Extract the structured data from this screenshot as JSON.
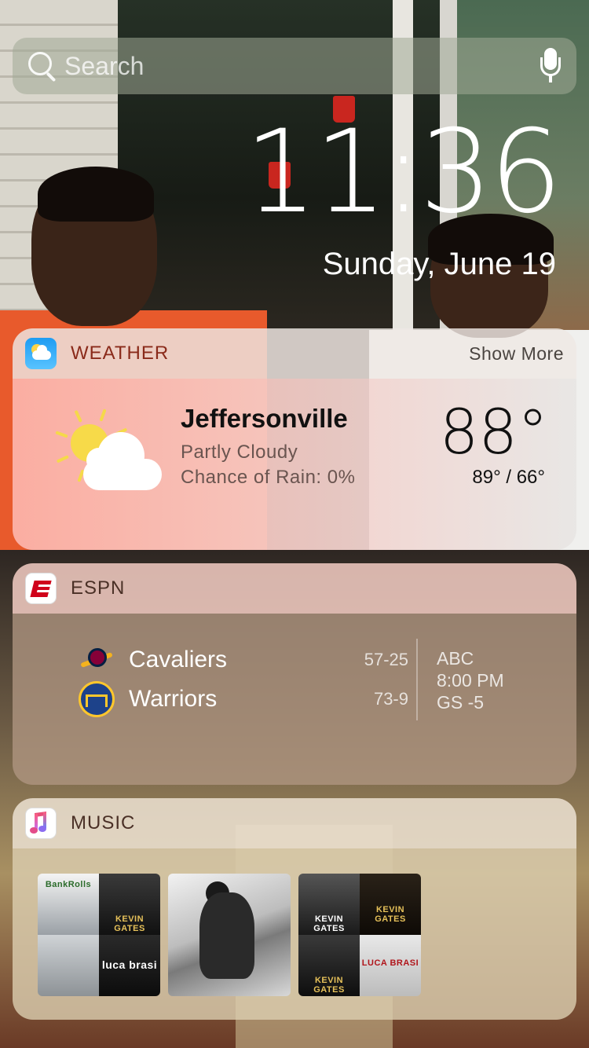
{
  "search": {
    "placeholder": "Search"
  },
  "clock": {
    "time": "11:36",
    "date": "Sunday, June 19"
  },
  "weather": {
    "title": "WEATHER",
    "show_more": "Show More",
    "city": "Jeffersonville",
    "condition": "Partly Cloudy",
    "rain": "Chance of Rain: 0%",
    "temperature": "88°",
    "hi_lo": "89° / 66°",
    "icon": "partly-cloudy-icon"
  },
  "espn": {
    "title": "ESPN",
    "teams": [
      {
        "name": "Cavaliers",
        "record": "57-25",
        "logo": "cavaliers-logo-icon"
      },
      {
        "name": "Warriors",
        "record": "73-9",
        "logo": "warriors-logo-icon"
      }
    ],
    "game": {
      "network": "ABC",
      "time": "8:00 PM",
      "line": "GS -5"
    }
  },
  "music": {
    "title": "MUSIC",
    "albums": [
      {
        "tiles": [
          "BankRolls",
          "KEVIN GATES",
          "",
          "luca brasi"
        ]
      },
      {
        "tiles": []
      },
      {
        "tiles": [
          "KEVIN GATES",
          "KEVIN GATES",
          "KEVIN GATES",
          "LUCA BRASI"
        ]
      }
    ]
  },
  "colors": {
    "weather_header_title": "#8a2a1a",
    "espn_red": "#d0021b"
  }
}
